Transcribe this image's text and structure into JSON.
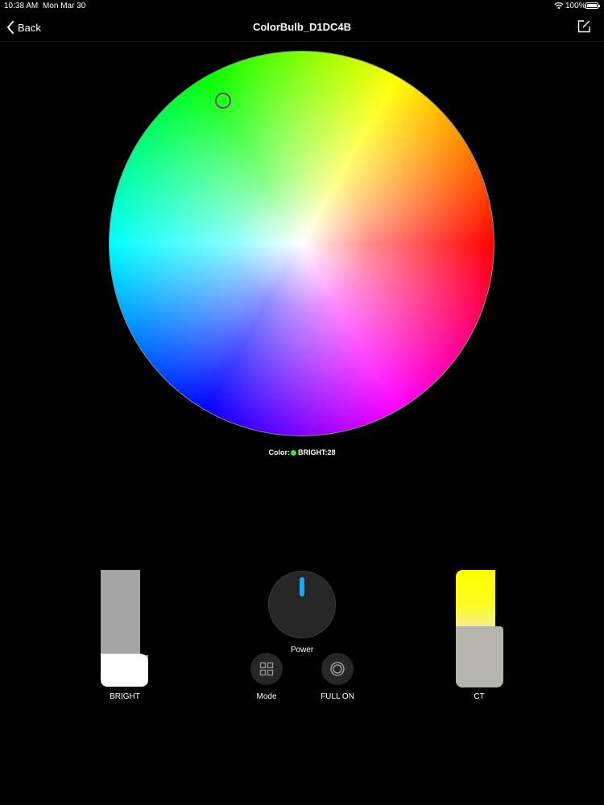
{
  "status_bar": {
    "time": "10:38 AM",
    "date": "Mon Mar 30",
    "battery": "100%"
  },
  "nav": {
    "back_label": "Back",
    "title": "ColorBulb_D1DC4B"
  },
  "color_info": {
    "color_label": "Color:",
    "selected_color": "#3de04a",
    "bright_label": "BRIGHT:28"
  },
  "controls": {
    "bright": {
      "label": "BRIGHT",
      "level": 0.28
    },
    "power": {
      "label": "Power",
      "indicator_color": "#1ea7ee"
    },
    "mode": {
      "label": "Mode",
      "icon": "grid-icon"
    },
    "full_on": {
      "label": "FULL ON",
      "icon": "concentric-circles-icon"
    },
    "ct": {
      "label": "CT",
      "level": 0.52
    }
  }
}
